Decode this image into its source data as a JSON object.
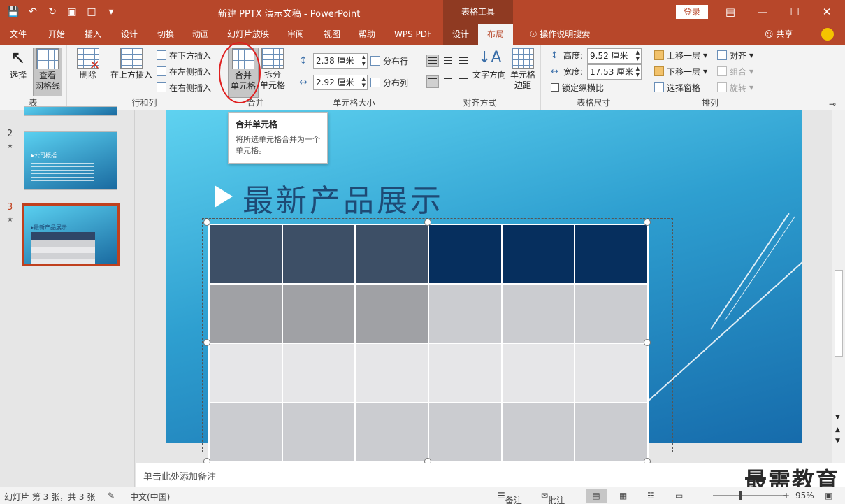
{
  "titlebar": {
    "doc_title": "新建 PPTX 演示文稿 - PowerPoint",
    "context_tab": "表格工具",
    "login": "登录",
    "accent": "#b7472a"
  },
  "tabs": [
    "文件",
    "开始",
    "插入",
    "设计",
    "切换",
    "动画",
    "幻灯片放映",
    "审阅",
    "视图",
    "帮助",
    "WPS PDF",
    "设计",
    "布局"
  ],
  "search_label": "操作说明搜索",
  "share_label": "共享",
  "ribbon": {
    "table_group": {
      "label": "表",
      "select": "选择",
      "view_gridlines": "查看\n网格线"
    },
    "rows_cols": {
      "label": "行和列",
      "delete": "删除",
      "insert_above": "在上方插入",
      "insert_below": "在下方插入",
      "insert_left": "在左侧插入",
      "insert_right": "在右侧插入"
    },
    "merge": {
      "label": "合并",
      "merge_cells": "合并\n单元格",
      "split_cells": "拆分\n单元格"
    },
    "cell_size": {
      "label": "单元格大小",
      "height_value": "2.38 厘米",
      "width_value": "2.92 厘米",
      "distribute_rows": "分布行",
      "distribute_cols": "分布列"
    },
    "alignment": {
      "label": "对齐方式",
      "text_direction": "文字方向",
      "cell_margins": "单元格\n边距"
    },
    "table_size": {
      "label": "表格尺寸",
      "height_label": "高度:",
      "height_value": "9.52 厘米",
      "width_label": "宽度:",
      "width_value": "17.53 厘米",
      "lock_ratio": "锁定纵横比"
    },
    "arrange": {
      "label": "排列",
      "bring_forward": "上移一层",
      "send_backward": "下移一层",
      "selection_pane": "选择窗格",
      "align": "对齐",
      "group": "组合",
      "rotate": "旋转"
    }
  },
  "tooltip": {
    "title": "合并单元格",
    "desc": "将所选单元格合并为一个单元格。"
  },
  "slides": [
    {
      "num": "2",
      "star": "★",
      "title": "公司概括"
    },
    {
      "num": "3",
      "star": "★",
      "title": "最新产品展示"
    }
  ],
  "slide": {
    "title": "最新产品展示",
    "table_colors": [
      [
        "#3d4f66",
        "#3d4f66",
        "#3d4f66",
        "#062f5e",
        "#062f5e",
        "#062f5e"
      ],
      [
        "#a0a1a5",
        "#a0a1a5",
        "#a0a1a5",
        "#cbccd0",
        "#cbccd0",
        "#cbccd0"
      ],
      [
        "#e6e6e8",
        "#e6e6e8",
        "#e6e6e8",
        "#e6e6e8",
        "#e6e6e8",
        "#e6e6e8"
      ],
      [
        "#cbccd0",
        "#cbccd0",
        "#cbccd0",
        "#cbccd0",
        "#cbccd0",
        "#cbccd0"
      ]
    ]
  },
  "notes_placeholder": "单击此处添加备注",
  "watermark": "最需教育",
  "status": {
    "slide_info": "幻灯片 第 3 张，共 3 张",
    "language": "中文(中国)",
    "notes": "备注",
    "comments": "批注",
    "zoom": "95%"
  }
}
